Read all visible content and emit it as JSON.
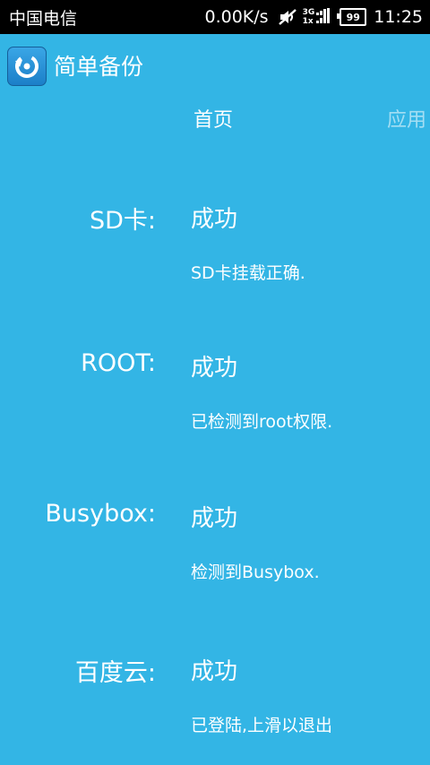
{
  "status_bar": {
    "carrier": "中国电信",
    "speed": "0.00K/s",
    "network_3g": "3G",
    "network_1x": "1x",
    "battery": "99",
    "time": "11:25",
    "icons": [
      "mute-icon",
      "signal-icon",
      "battery-icon"
    ]
  },
  "action_bar": {
    "app_title": "简单备份",
    "app_icon": "backup-restore-icon"
  },
  "tabs": [
    {
      "label": "首页",
      "selected": true
    },
    {
      "label": "应用",
      "selected": false
    }
  ],
  "checks": [
    {
      "label": "SD卡:",
      "status": "成功",
      "detail": "SD卡挂载正确."
    },
    {
      "label": "ROOT:",
      "status": "成功",
      "detail": "已检测到root权限."
    },
    {
      "label": "Busybox:",
      "status": "成功",
      "detail": "检测到Busybox."
    },
    {
      "label": "百度云:",
      "status": "成功",
      "detail": "已登陆,上滑以退出"
    }
  ],
  "colors": {
    "background": "#33b5e5",
    "status_bar": "#000000",
    "text": "#ffffff"
  }
}
